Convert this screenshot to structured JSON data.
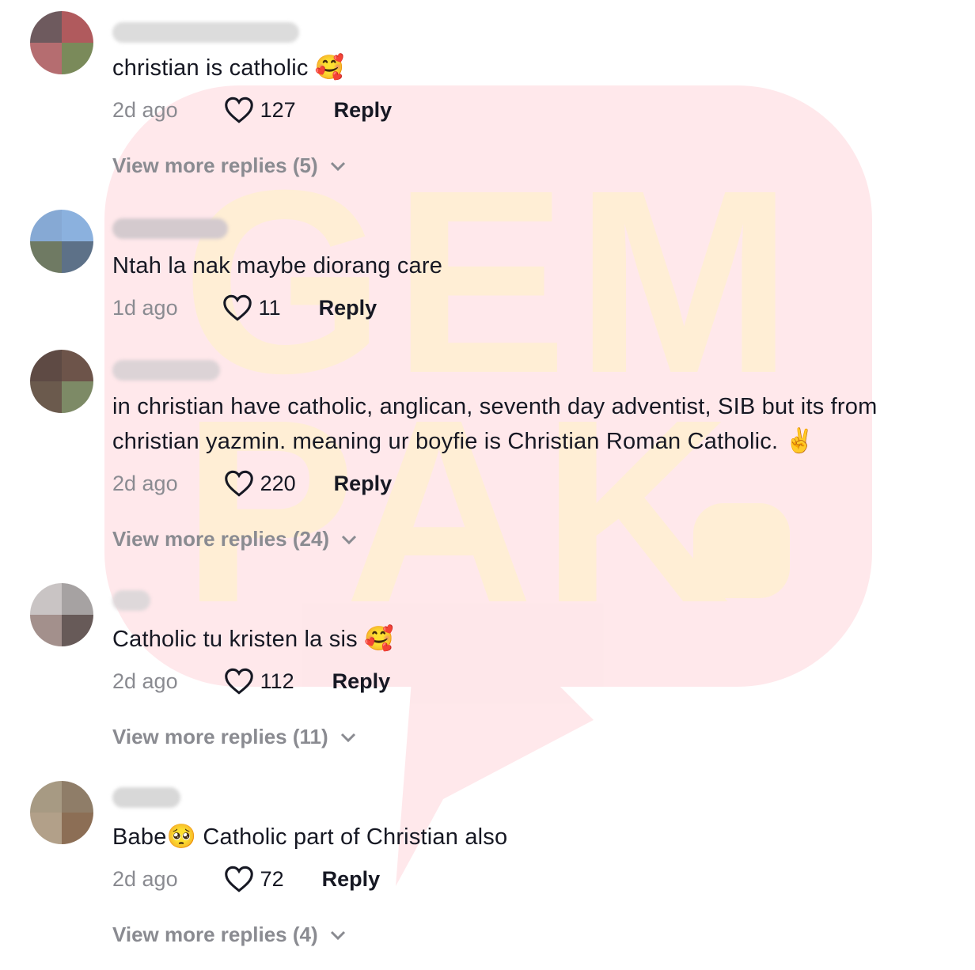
{
  "watermark": {
    "brand_color": "#fb2c4a",
    "text_color": "#fff3c4",
    "line1": "GEM",
    "line2": "PAK"
  },
  "colors": {
    "text": "#161823",
    "muted": "#8a8b91"
  },
  "comments": [
    {
      "text": "christian is catholic",
      "emoji": "🥰",
      "time": "2d ago",
      "likes": "127",
      "reply_label": "Reply",
      "more_replies": "View more replies (5)"
    },
    {
      "text": "Ntah la nak maybe diorang care",
      "time": "1d ago",
      "likes": "11",
      "reply_label": "Reply"
    },
    {
      "text_line1": "in christian have catholic, anglican, seventh day adventist, SIB but its from",
      "text_line2": "christian yazmin. meaning ur boyfie is Christian Roman Catholic.",
      "emoji": "✌️",
      "time": "2d ago",
      "likes": "220",
      "reply_label": "Reply",
      "more_replies": "View more replies (24)"
    },
    {
      "text": "Catholic tu kristen la sis",
      "emoji": "🥰",
      "time": "2d ago",
      "likes": "112",
      "reply_label": "Reply",
      "more_replies": "View more replies (11)"
    },
    {
      "text_prefix": "Babe",
      "emoji": "🥺",
      "text": " Catholic part of Christian also",
      "time": "2d ago",
      "likes": "72",
      "reply_label": "Reply",
      "more_replies": "View more replies (4)"
    }
  ]
}
